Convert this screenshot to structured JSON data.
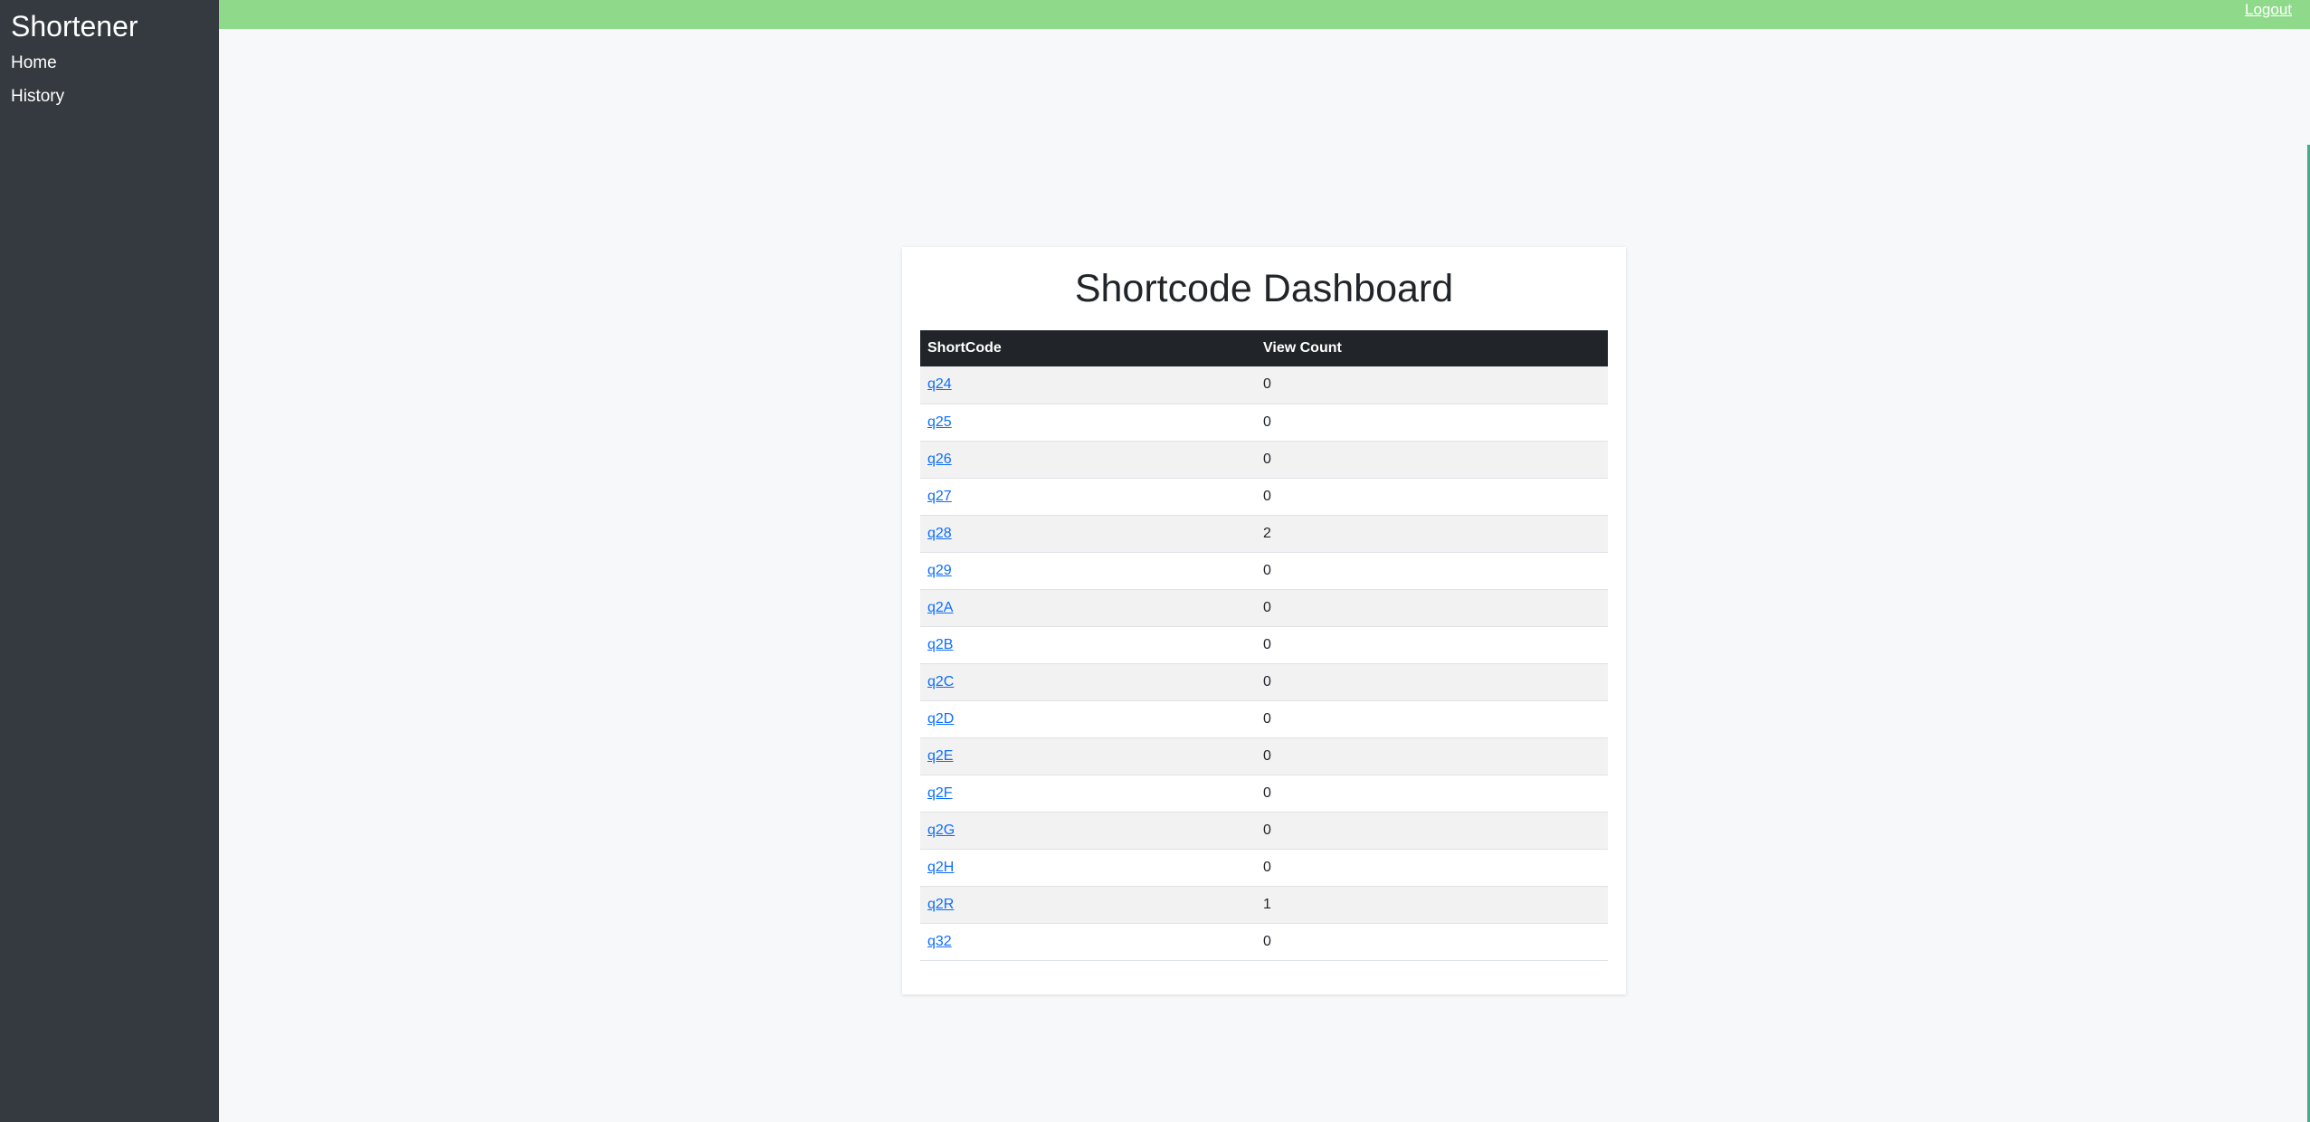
{
  "sidebar": {
    "brand": "Shortener",
    "items": [
      {
        "label": "Home"
      },
      {
        "label": "History"
      }
    ]
  },
  "topbar": {
    "logout_label": "Logout",
    "color": "#8fda8a"
  },
  "main": {
    "title": "Shortcode Dashboard",
    "table": {
      "headers": [
        "ShortCode",
        "View Count"
      ],
      "rows": [
        {
          "code": "q24",
          "count": "0"
        },
        {
          "code": "q25",
          "count": "0"
        },
        {
          "code": "q26",
          "count": "0"
        },
        {
          "code": "q27",
          "count": "0"
        },
        {
          "code": "q28",
          "count": "2"
        },
        {
          "code": "q29",
          "count": "0"
        },
        {
          "code": "q2A",
          "count": "0"
        },
        {
          "code": "q2B",
          "count": "0"
        },
        {
          "code": "q2C",
          "count": "0"
        },
        {
          "code": "q2D",
          "count": "0"
        },
        {
          "code": "q2E",
          "count": "0"
        },
        {
          "code": "q2F",
          "count": "0"
        },
        {
          "code": "q2G",
          "count": "0"
        },
        {
          "code": "q2H",
          "count": "0"
        },
        {
          "code": "q2R",
          "count": "1"
        },
        {
          "code": "q32",
          "count": "0"
        }
      ]
    }
  },
  "colors": {
    "sidebar_bg": "#343a40",
    "table_header_bg": "#212529",
    "link": "#0d6efd"
  }
}
